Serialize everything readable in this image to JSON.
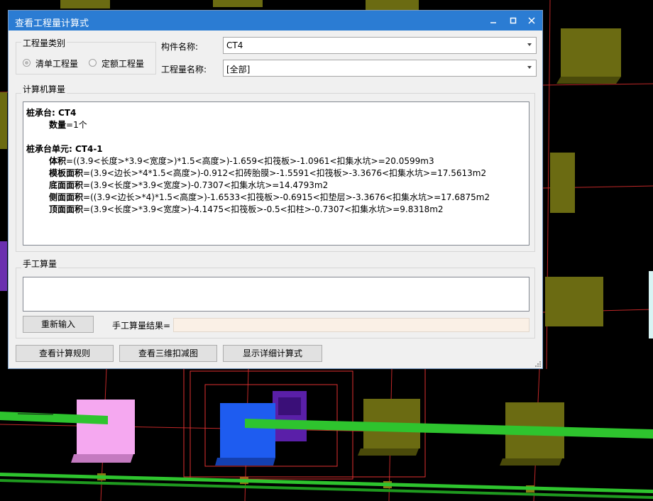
{
  "dialog": {
    "title": "查看工程量计算式",
    "window_controls": {
      "minimize": "minimize-icon",
      "maximize": "maximize-icon",
      "close": "close-icon"
    }
  },
  "quantity_category": {
    "label": "工程量类别",
    "options": [
      "清单工程量",
      "定额工程量"
    ],
    "selected": "清单工程量"
  },
  "component": {
    "label": "构件名称:",
    "value": "CT4"
  },
  "quantity_name": {
    "label": "工程量名称:",
    "value": "[全部]"
  },
  "computer": {
    "label": "计算机算量",
    "results": [
      {
        "head": "桩承台: CT4",
        "rest": "",
        "indent": false
      },
      {
        "head": "数量",
        "rest": "=1个",
        "indent": true
      },
      {
        "head": "",
        "rest": "",
        "indent": false
      },
      {
        "head": "桩承台单元: CT4-1",
        "rest": "",
        "indent": false
      },
      {
        "head": "体积",
        "rest": "=((3.9<长度>*3.9<宽度>)*1.5<高度>)-1.659<扣筏板>-1.0961<扣集水坑>=20.0599m3",
        "indent": true
      },
      {
        "head": "模板面积",
        "rest": "=(3.9<边长>*4*1.5<高度>)-0.912<扣砖胎膜>-1.5591<扣筏板>-3.3676<扣集水坑>=17.5613m2",
        "indent": true
      },
      {
        "head": "底面面积",
        "rest": "=(3.9<长度>*3.9<宽度>)-0.7307<扣集水坑>=14.4793m2",
        "indent": true
      },
      {
        "head": "侧面面积",
        "rest": "=((3.9<边长>*4)*1.5<高度>)-1.6533<扣筏板>-0.6915<扣垫层>-3.3676<扣集水坑>=17.6875m2",
        "indent": true
      },
      {
        "head": "顶面面积",
        "rest": "=(3.9<长度>*3.9<宽度>)-4.1475<扣筏板>-0.5<扣柱>-0.7307<扣集水坑>=9.8318m2",
        "indent": true
      }
    ]
  },
  "manual": {
    "label": "手工算量",
    "input_value": "",
    "reenter_button": "重新输入",
    "result_label": "手工算量结果=",
    "result_value": ""
  },
  "footer_buttons": {
    "rules": "查看计算规则",
    "view3d": "查看三维扣减图",
    "detail": "显示详细计算式"
  },
  "colors": {
    "titlebar": "#2b7cd3",
    "beam_green": "#2ec42e",
    "pile_cap_olive": "#6b6b12",
    "selection_red": "#e03030",
    "highlight_blue": "#1e5cf0",
    "pit_purple": "#5a1fa8",
    "pink_block": "#f5a8f0"
  }
}
